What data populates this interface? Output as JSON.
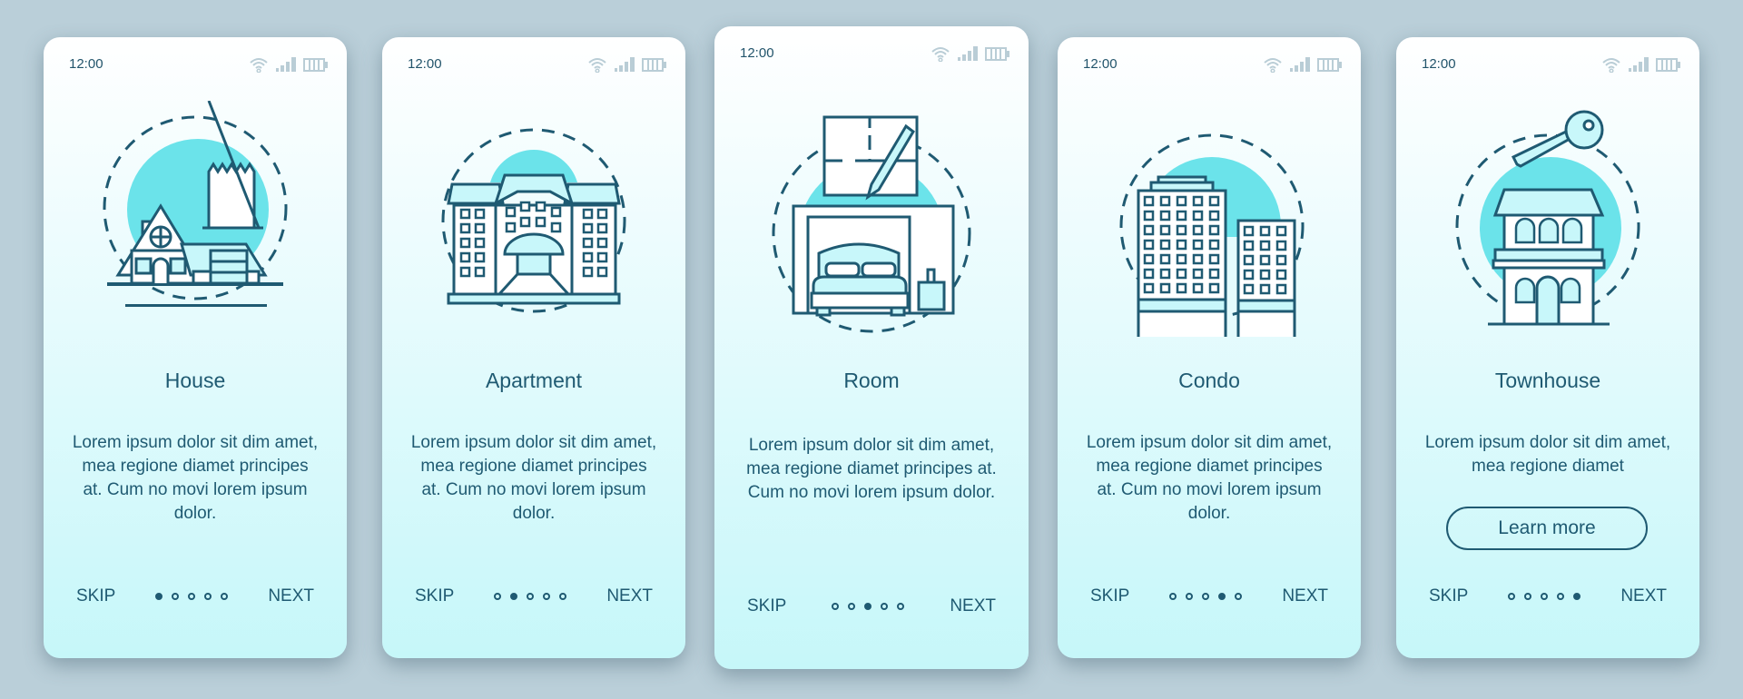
{
  "theme": {
    "background": "#bacfd9",
    "text": "#1f5a72",
    "accent": "#6be3ea",
    "light_fill": "#c8f7fa",
    "status_icons": "#b9cdd6"
  },
  "screens": [
    {
      "time": "12:00",
      "illustration": "house-icon",
      "title": "House",
      "body": "Lorem ipsum dolor sit dim amet, mea regione diamet principes at. Cum no movi lorem ipsum dolor.",
      "skip": "SKIP",
      "next": "NEXT",
      "active_page": 1,
      "total_pages": 5
    },
    {
      "time": "12:00",
      "illustration": "apartment-building-icon",
      "title": "Apartment",
      "body": "Lorem ipsum dolor sit dim amet, mea regione diamet principes at. Cum no movi lorem ipsum dolor.",
      "skip": "SKIP",
      "next": "NEXT",
      "active_page": 2,
      "total_pages": 5
    },
    {
      "time": "12:00",
      "illustration": "room-bed-floorplan-icon",
      "title": "Room",
      "body": "Lorem ipsum dolor sit dim amet, mea regione diamet principes at. Cum no movi lorem ipsum dolor.",
      "skip": "SKIP",
      "next": "NEXT",
      "active_page": 3,
      "total_pages": 5
    },
    {
      "time": "12:00",
      "illustration": "condo-towers-icon",
      "title": "Condo",
      "body": "Lorem ipsum dolor sit dim amet, mea regione diamet principes at. Cum no movi lorem ipsum dolor.",
      "skip": "SKIP",
      "next": "NEXT",
      "active_page": 4,
      "total_pages": 5
    },
    {
      "time": "12:00",
      "illustration": "townhouse-key-icon",
      "title": "Townhouse",
      "body": "Lorem ipsum dolor sit dim amet, mea regione diamet",
      "button": "Learn more",
      "skip": "SKIP",
      "next": "NEXT",
      "active_page": 5,
      "total_pages": 5
    }
  ],
  "status_icons": [
    "wifi-icon",
    "signal-icon",
    "battery-icon"
  ]
}
